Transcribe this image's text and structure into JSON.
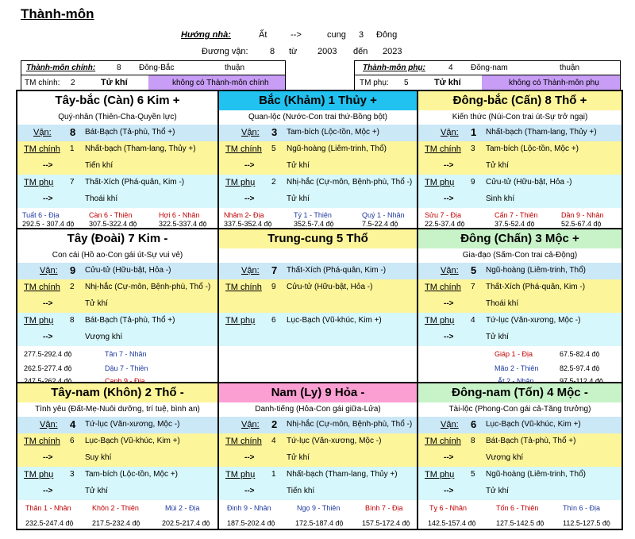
{
  "title": "Thành-môn",
  "huong_nha": {
    "label": "Hướng nhà:",
    "from": "Ất",
    "arrow": "-->",
    "cung_label": "cung",
    "cung_num": "3",
    "cung_name": "Đông"
  },
  "duong_van": {
    "label": "Đương vận:",
    "num": "8",
    "tu": "từ",
    "from": "2003",
    "den": "đến",
    "to": "2023"
  },
  "tm_chinh_box": {
    "label": "Thành-môn chính:",
    "num": "8",
    "dir": "Đông-Bắc",
    "state": "thuận",
    "label2": "TM chính:",
    "num2": "2",
    "tukhi": "Tử khí",
    "note": "không có Thành-môn chính"
  },
  "tm_phu_box": {
    "label": "Thành-môn phụ:",
    "num": "4",
    "dir": "Đông-nam",
    "state": "thuận",
    "label2": "TM phụ:",
    "num2": "5",
    "tukhi": "Tử khí",
    "note": "không có Thành-môn phụ"
  },
  "cells": [
    {
      "title": "Tây-bắc (Càn) 6 Kim +",
      "sub": "Quý-nhân (Thiên-Cha-Quyền lực)",
      "van": "8",
      "van_desc": "Bát-Bạch (Tả-phù, Thổ +)",
      "tmc": "1",
      "tmc_desc": "Nhất-bạch (Tham-lang, Thủy +)",
      "tmc_khi": "Tiến khí",
      "tmp": "7",
      "tmp_desc": "Thất-Xích (Phá-quân, Kim -)",
      "tmp_khi": "Thoái khí",
      "sons": [
        "Tuất 6 - Địa",
        "Càn 6 - Thiên",
        "Hợi 6 - Nhân"
      ],
      "degs": [
        "292.5 - 307.4 độ",
        "307.5-322.4 độ",
        "322.5-337.4 độ"
      ]
    },
    {
      "title": "Bắc (Khảm) 1 Thủy +",
      "sub": "Quan-lộc (Nước-Con trai thứ-Bồng bột)",
      "van": "3",
      "van_desc": "Tam-bích (Lộc-tồn, Mộc +)",
      "tmc": "5",
      "tmc_desc": "Ngũ-hoàng (Liêm-trinh, Thổ)",
      "tmc_khi": "Tử khí",
      "tmp": "2",
      "tmp_desc": "Nhị-hắc (Cự-môn, Bệnh-phù, Thổ -)",
      "tmp_khi": "Tử khí",
      "sons": [
        "Nhâm 2- Địa",
        "Tý 1 - Thiên",
        "Quý 1 - Nhân"
      ],
      "degs": [
        "337.5-352.4 độ",
        "352.5-7.4 độ",
        "7.5-22.4 độ"
      ]
    },
    {
      "title": "Đông-bắc (Cấn) 8 Thổ +",
      "sub": "Kiến thức (Núi-Con trai út-Sự trở ngại)",
      "van": "1",
      "van_desc": "Nhất-bạch (Tham-lang, Thủy +)",
      "tmc": "3",
      "tmc_desc": "Tam-bích (Lộc-tồn, Mộc +)",
      "tmc_khi": "Tử khí",
      "tmp": "9",
      "tmp_desc": "Cửu-tử (Hữu-bật, Hỏa -)",
      "tmp_khi": "Sinh khí",
      "sons": [
        "Sửu 7 - Địa",
        "Cấn 7 - Thiên",
        "Dần 9 - Nhân"
      ],
      "degs": [
        "22.5-37.4 độ",
        "37.5-52.4 độ",
        "52.5-67.4 độ"
      ]
    },
    {
      "title": "Tây (Đoài) 7 Kim -",
      "sub": "Con cái (Hồ ao-Con gái út-Sự vui vẻ)",
      "van": "9",
      "van_desc": "Cửu-tử (Hữu-bật, Hỏa -)",
      "tmc": "2",
      "tmc_desc": "Nhị-hắc (Cự-môn, Bệnh-phù, Thổ -)",
      "tmc_khi": "Tử khí",
      "tmp": "8",
      "tmp_desc": "Bát-Bạch (Tả-phù, Thổ +)",
      "tmp_khi": "Vượng khí",
      "side": [
        [
          "277.5-292.4 độ",
          "Tân 7 - Nhân"
        ],
        [
          "262.5-277.4 độ",
          "Dậu 7 - Thiên"
        ],
        [
          "247.5-262.4 độ",
          "Canh 9 - Địa"
        ]
      ]
    },
    {
      "title": "Trung-cung 5 Thổ",
      "van": "7",
      "van_desc": "Thất-Xích (Phá-quân, Kim -)",
      "tmc": "9",
      "tmc_desc": "Cửu-tử (Hữu-bật, Hỏa -)",
      "tmp": "6",
      "tmp_desc": "Lục-Bạch (Vũ-khúc, Kim +)"
    },
    {
      "title": "Đông (Chấn) 3 Mộc +",
      "sub": "Gia-đạo (Sấm-Con trai cả-Động)",
      "van": "5",
      "van_desc": "Ngũ-hoàng (Liêm-trinh, Thổ)",
      "tmc": "7",
      "tmc_desc": "Thất-Xích (Phá-quân, Kim -)",
      "tmc_khi": "Thoái khí",
      "tmp": "4",
      "tmp_desc": "Tứ-lục (Văn-xương, Mộc -)",
      "tmp_khi": "Tử khí",
      "side": [
        [
          "Giáp 1 - Địa",
          "67.5-82.4 độ"
        ],
        [
          "Mão 2 - Thiên",
          "82.5-97.4 độ"
        ],
        [
          "Ất 2 - Nhân",
          "97.5-112.4 độ"
        ]
      ]
    },
    {
      "title": "Tây-nam (Khôn) 2 Thổ -",
      "sub": "Tình yêu (Đất-Mẹ-Nuôi dưỡng, trí tuệ, bình an)",
      "van": "4",
      "van_desc": "Tứ-lục (Văn-xương, Mộc -)",
      "tmc": "6",
      "tmc_desc": "Lục-Bạch (Vũ-khúc, Kim +)",
      "tmc_khi": "Suy khí",
      "tmp": "3",
      "tmp_desc": "Tam-bích (Lộc-tồn, Mộc +)",
      "tmp_khi": "Tử khí",
      "sons": [
        "Thân 1 - Nhân",
        "Khôn 2 - Thiên",
        "Mùi 2 - Địa"
      ],
      "degs": [
        "232.5-247.4 độ",
        "217.5-232.4 độ",
        "202.5-217.4 độ"
      ]
    },
    {
      "title": "Nam (Ly) 9 Hỏa -",
      "sub": "Danh-tiếng (Hỏa-Con gái giữa-Lửa)",
      "van": "2",
      "van_desc": "Nhị-hắc (Cự-môn, Bệnh-phù, Thổ -)",
      "tmc": "4",
      "tmc_desc": "Tứ-lục (Văn-xương, Mộc -)",
      "tmc_khi": "Tử khí",
      "tmp": "1",
      "tmp_desc": "Nhất-bạch (Tham-lang, Thủy +)",
      "tmp_khi": "Tiến khí",
      "sons": [
        "Đinh 9 - Nhân",
        "Ngọ 9 - Thiên",
        "Bính 7 - Địa"
      ],
      "degs": [
        "187.5-202.4 độ",
        "172.5-187.4 độ",
        "157.5-172.4 độ"
      ]
    },
    {
      "title": "Đông-nam (Tốn) 4 Mộc -",
      "sub": "Tài-lộc (Phong-Con gái cả-Tăng trưởng)",
      "van": "6",
      "van_desc": "Lục-Bạch (Vũ-khúc, Kim +)",
      "tmc": "8",
      "tmc_desc": "Bát-Bạch (Tả-phù, Thổ +)",
      "tmc_khi": "Vượng khí",
      "tmp": "5",
      "tmp_desc": "Ngũ-hoàng (Liêm-trinh, Thổ)",
      "tmp_khi": "Tử khí",
      "sons": [
        "Tỵ 6 - Nhân",
        "Tốn 6 - Thiên",
        "Thìn 6 - Địa"
      ],
      "degs": [
        "142.5-157.4 độ",
        "127.5-142.5 độ",
        "112.5-127.5 độ"
      ]
    }
  ],
  "labels": {
    "van": "Vận:",
    "tmc": "TM chính",
    "tmp": "TM phụ",
    "arrow": "-->"
  },
  "colors": {
    "cyan": "#21c2f0",
    "yellow": "#fdf59a",
    "green": "#c8f3c8",
    "pink": "#fb9fd3",
    "lightblue": "#cbe8f7",
    "lightcyan": "#d6f7fb",
    "purple": "#c79df5"
  }
}
